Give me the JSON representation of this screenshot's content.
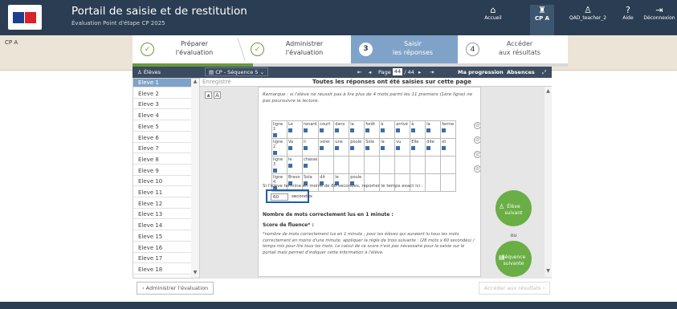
{
  "header": {
    "title": "Portail de saisie et de restitution",
    "subtitle": "Évaluation Point d'étape CP 2025",
    "nav": [
      {
        "label": "Accueil",
        "icon": "home-icon"
      },
      {
        "label": "CP A",
        "icon": "class-icon"
      },
      {
        "label": "QAD_teacher_2",
        "icon": "user-icon"
      },
      {
        "label": "Aide",
        "icon": "help-icon"
      },
      {
        "label": "Déconnexion",
        "icon": "logout-icon"
      }
    ]
  },
  "context": {
    "class_label": "CP A"
  },
  "steps": [
    {
      "num": "✓",
      "line1": "Préparer",
      "line2": "l'évaluation",
      "state": "done"
    },
    {
      "num": "✓",
      "line1": "Administrer",
      "line2": "l'évaluation",
      "state": "done"
    },
    {
      "num": "3",
      "line1": "Saisir",
      "line2": "les réponses",
      "state": "current"
    },
    {
      "num": "4",
      "line1": "Accéder",
      "line2": "aux résultats",
      "state": "next"
    }
  ],
  "toolbar": {
    "eleves_label": "Élèves",
    "sequence": "CP - Séquence 5",
    "page_prefix": "Page",
    "page_current": "44",
    "page_total": "/ 44",
    "progression": "Ma progression",
    "absences": "Absences"
  },
  "students": [
    "Eleve 1",
    "Eleve 2",
    "Eleve 3",
    "Eleve 4",
    "Eleve 5",
    "Eleve 6",
    "Eleve 7",
    "Eleve 8",
    "Eleve 9",
    "Eleve 10",
    "Eleve 11",
    "Eleve 12",
    "Eleve 13",
    "Eleve 14",
    "Eleve 15",
    "Eleve 16",
    "Eleve 17",
    "Eleve 18"
  ],
  "selected_student_index": 0,
  "main": {
    "saved_label": "Enregistré",
    "all_saved": "Toutes les réponses ont été saisies sur cette page",
    "remark": "Remarque : si l'élève ne réussit pas à lire plus de 4 mots parmi les 11 premiers (1ère ligne) ne pas poursuivre la lecture.",
    "grid": [
      [
        "ligne 1",
        "Le",
        "renard",
        "court",
        "dans",
        "la",
        "forêt",
        "à",
        "arrivé",
        "à",
        "la",
        "ferme"
      ],
      [
        "ligne 2",
        "Va",
        "il",
        "voler",
        "une",
        "poule",
        "Sola",
        "la",
        "vu",
        "Elle",
        "dite",
        "et"
      ],
      [
        "ligne 3",
        "le",
        "chasse",
        "",
        "",
        "",
        "",
        "",
        "",
        "",
        "",
        ""
      ],
      [
        "ligne 4",
        "Bravo",
        "Sola",
        "dit",
        "le",
        "poule",
        "",
        "",
        "",
        "",
        "",
        ""
      ]
    ],
    "q60": "Si l'élève termine en moins de 60 secondes, reporter le temps exact ici :",
    "seconds_value": "60",
    "seconds_unit": "secondes",
    "nb_mots": "Nombre de mots correctement lus en 1 minute :",
    "score": "Score de fluence* :",
    "note": "*nombre de mots correctement lus en 1 minute ; pour les élèves qui auraient lu tous les mots correctement en moins d'une minute, appliquer la règle de trois suivante : (28 mots x 60 secondes) / temps mis pour lire tous les mots. Le calcul de ce score n'est pas nécessaire pour la saisie sur le portail mais permet d'indiquer cette information à l'élève."
  },
  "side": {
    "next_student_l1": "Élève",
    "next_student_l2": "suivant",
    "or": "ou",
    "next_seq_l1": "Séquence",
    "next_seq_l2": "suivante"
  },
  "footer": {
    "back": "‹  Administrer l'évaluation",
    "forward": "Accéder aux résultats  ›"
  },
  "colors": {
    "header": "#2a3d52",
    "accent": "#7fa3c8",
    "green": "#6aae46",
    "highlight": "#1f5ea8"
  }
}
